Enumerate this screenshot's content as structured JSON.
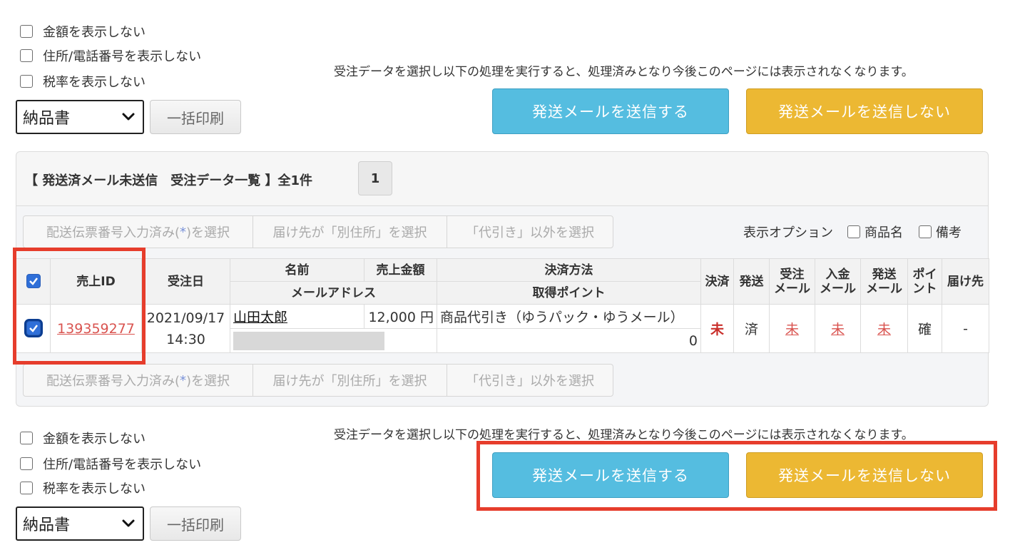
{
  "options": [
    "金額を表示しない",
    "住所/電話番号を表示しない",
    "税率を表示しない"
  ],
  "doc_select": {
    "value": "納品書"
  },
  "bulk_print_label": "一括印刷",
  "notice_text": "受注データを選択し以下の処理を実行すると、処理済みとなり今後このページには表示されなくなります。",
  "send_button_label": "発送メールを送信する",
  "nosend_button_label": "発送メールを送信しない",
  "panel": {
    "title": "【 発送済メール未送信　受注データ一覧 】全1件",
    "page": "1",
    "select_buttons": {
      "slip_prefix": "配送伝票番号入力済み(",
      "slip_star": "*",
      "slip_suffix": ")を選択",
      "other_address": "届け先が「別住所」を選択",
      "non_cod": "「代引き」以外を選択"
    },
    "display_option_label": "表示オプション",
    "display_options": [
      "商品名",
      "備考"
    ]
  },
  "table": {
    "headers": {
      "sales_id": "売上ID",
      "order_date": "受注日",
      "name": "名前",
      "amount": "売上金額",
      "payment_method": "決済方法",
      "email": "メールアドレス",
      "points_earned": "取得ポイント",
      "settled": "決済",
      "shipped": "発送",
      "order_mail_1": "受注",
      "order_mail_2": "メール",
      "payment_mail_1": "入金",
      "payment_mail_2": "メール",
      "ship_mail_1": "発送",
      "ship_mail_2": "メール",
      "point_1": "ポイ",
      "point_2": "ント",
      "destination": "届け先"
    },
    "row": {
      "sales_id": "139359277",
      "date": "2021/09/17",
      "time": "14:30",
      "name": "山田太郎",
      "amount": "12,000 円",
      "payment_method": "商品代引き（ゆうパック・ゆうメール）",
      "points": "0",
      "settled": "未",
      "shipped": "済",
      "order_mail": "未",
      "payment_mail": "未",
      "ship_mail": "未",
      "point": "確",
      "destination": "-"
    }
  },
  "colors": {
    "blue_button": "#55bde0",
    "yellow_button": "#ecb833",
    "highlight_red": "#e63d2c",
    "link_red": "#d9534f"
  }
}
